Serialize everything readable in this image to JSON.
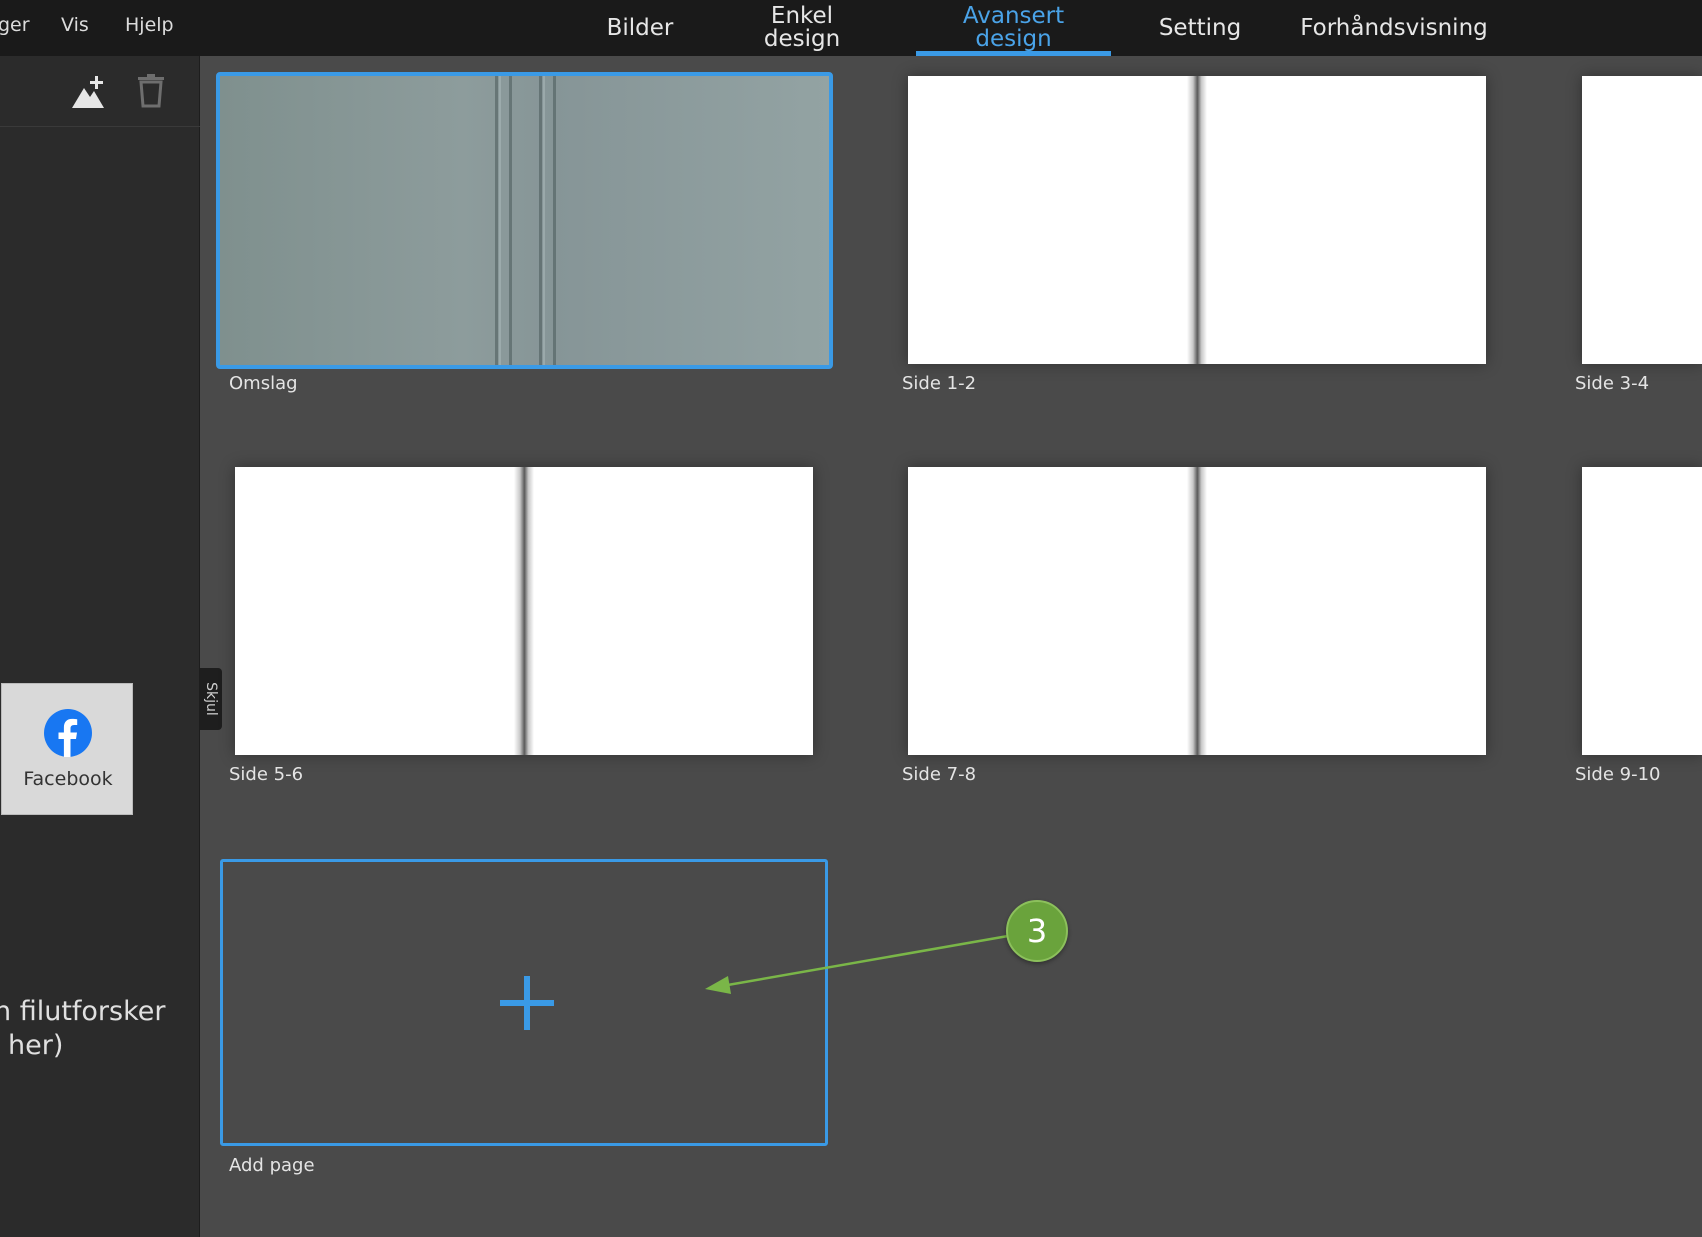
{
  "menu": {
    "items": [
      "ger",
      "Vis",
      "Hjelp"
    ]
  },
  "tabs": [
    {
      "label": "Bilder"
    },
    {
      "label": "Enkel\ndesign"
    },
    {
      "label": "Avansert\ndesign",
      "active": true
    },
    {
      "label": "Setting"
    },
    {
      "label": "Forhåndsvisning"
    }
  ],
  "sidebar": {
    "toolbar_icons": [
      "add-image-icon",
      "trash-icon"
    ],
    "facebook_label": "Facebook",
    "browser_text_line1": "n filutforsker",
    "browser_text_line2": "her)",
    "hide_label": "Skjul"
  },
  "pages": [
    {
      "label": "Omslag",
      "selected": true
    },
    {
      "label": "Side 1-2"
    },
    {
      "label": "Side 3-4"
    },
    {
      "label": "Side 5-6"
    },
    {
      "label": "Side 7-8"
    },
    {
      "label": "Side 9-10"
    }
  ],
  "add_page": {
    "label": "Add page"
  },
  "annotation": {
    "number": "3"
  },
  "colors": {
    "accent": "#3a9ae6",
    "topbar": "#1a1a1a",
    "sidebar": "#2b2b2b",
    "canvas": "#4a4a4a",
    "annotation": "#6aa33c",
    "facebook": "#1877f2"
  }
}
